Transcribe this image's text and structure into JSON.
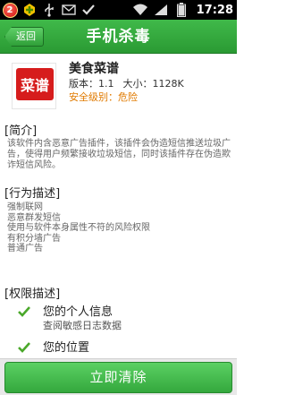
{
  "status_bar": {
    "notification_count": "2",
    "time": "17:28",
    "icons": [
      "notification-badge-icon",
      "game-pad-icon",
      "usb-icon",
      "mail-icon",
      "check-icon",
      "wifi-icon",
      "signal-icon",
      "battery-icon"
    ]
  },
  "header": {
    "back_label": "返回",
    "title": "手机杀毒"
  },
  "app": {
    "icon_text": "菜谱",
    "name": "美食菜谱",
    "version": "版本：1.1",
    "size": "大小：1128K",
    "safety": "安全级别：危险"
  },
  "intro": {
    "heading": "[简介]",
    "text": "该软件内含恶意广告插件，该插件会伪造短信推送垃圾广告，使得用户频繁接收垃圾短信，同时该插件存在伪造欺诈短信风险。"
  },
  "behavior": {
    "heading": "[行为描述]",
    "items": [
      "强制联网",
      "恶意群发短信",
      "使用与软件本身属性不符的风险权限",
      "有积分墙广告",
      "普通广告"
    ]
  },
  "permissions": {
    "heading": "[权限描述]",
    "items": [
      {
        "title": "您的个人信息",
        "desc": "查阅敏感日志数据"
      },
      {
        "title": "您的位置",
        "desc": ""
      }
    ]
  },
  "action": {
    "clean_label": "立即清除"
  },
  "colors": {
    "accent_green": "#34a83d",
    "danger_orange": "#e07a00"
  }
}
